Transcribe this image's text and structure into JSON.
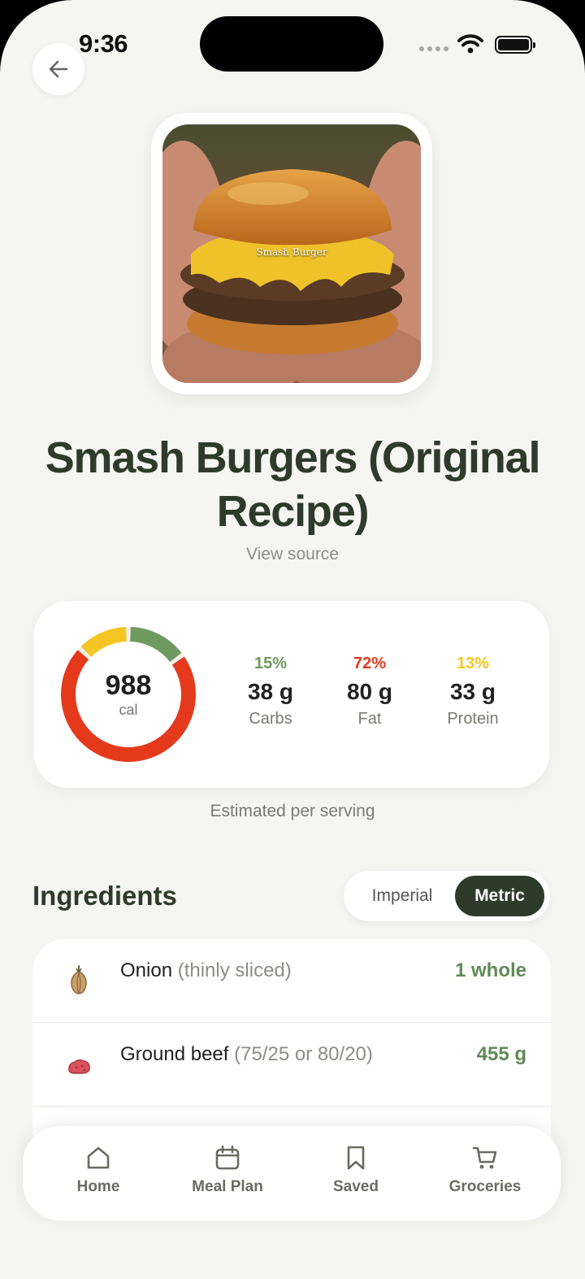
{
  "status_bar": {
    "time": "9:36"
  },
  "hero": {
    "caption": "Smash Burger"
  },
  "recipe": {
    "title": "Smash Burgers (Original Recipe)",
    "view_source": "View source"
  },
  "nutrition": {
    "calories": "988",
    "calories_unit": "cal",
    "macros": [
      {
        "pct": "15%",
        "grams": "38 g",
        "name": "Carbs",
        "color": "#6e9a5f",
        "fraction": 0.15
      },
      {
        "pct": "72%",
        "grams": "80 g",
        "name": "Fat",
        "color": "#e5391c",
        "fraction": 0.72
      },
      {
        "pct": "13%",
        "grams": "33 g",
        "name": "Protein",
        "color": "#f3c623",
        "fraction": 0.13
      }
    ],
    "note": "Estimated per serving"
  },
  "ingredients": {
    "title": "Ingredients",
    "units": {
      "imperial": "Imperial",
      "metric": "Metric",
      "selected": "Metric"
    },
    "items": [
      {
        "name": "Onion",
        "note": "(thinly sliced)",
        "qty": "1 whole",
        "icon": "onion-icon"
      },
      {
        "name": "Ground beef",
        "note": "(75/25 or 80/20)",
        "qty": "455 g",
        "icon": "beef-icon"
      }
    ]
  },
  "tabs": [
    {
      "label": "Home",
      "icon": "home-icon"
    },
    {
      "label": "Meal Plan",
      "icon": "calendar-icon"
    },
    {
      "label": "Saved",
      "icon": "bookmark-icon"
    },
    {
      "label": "Groceries",
      "icon": "cart-icon"
    }
  ]
}
